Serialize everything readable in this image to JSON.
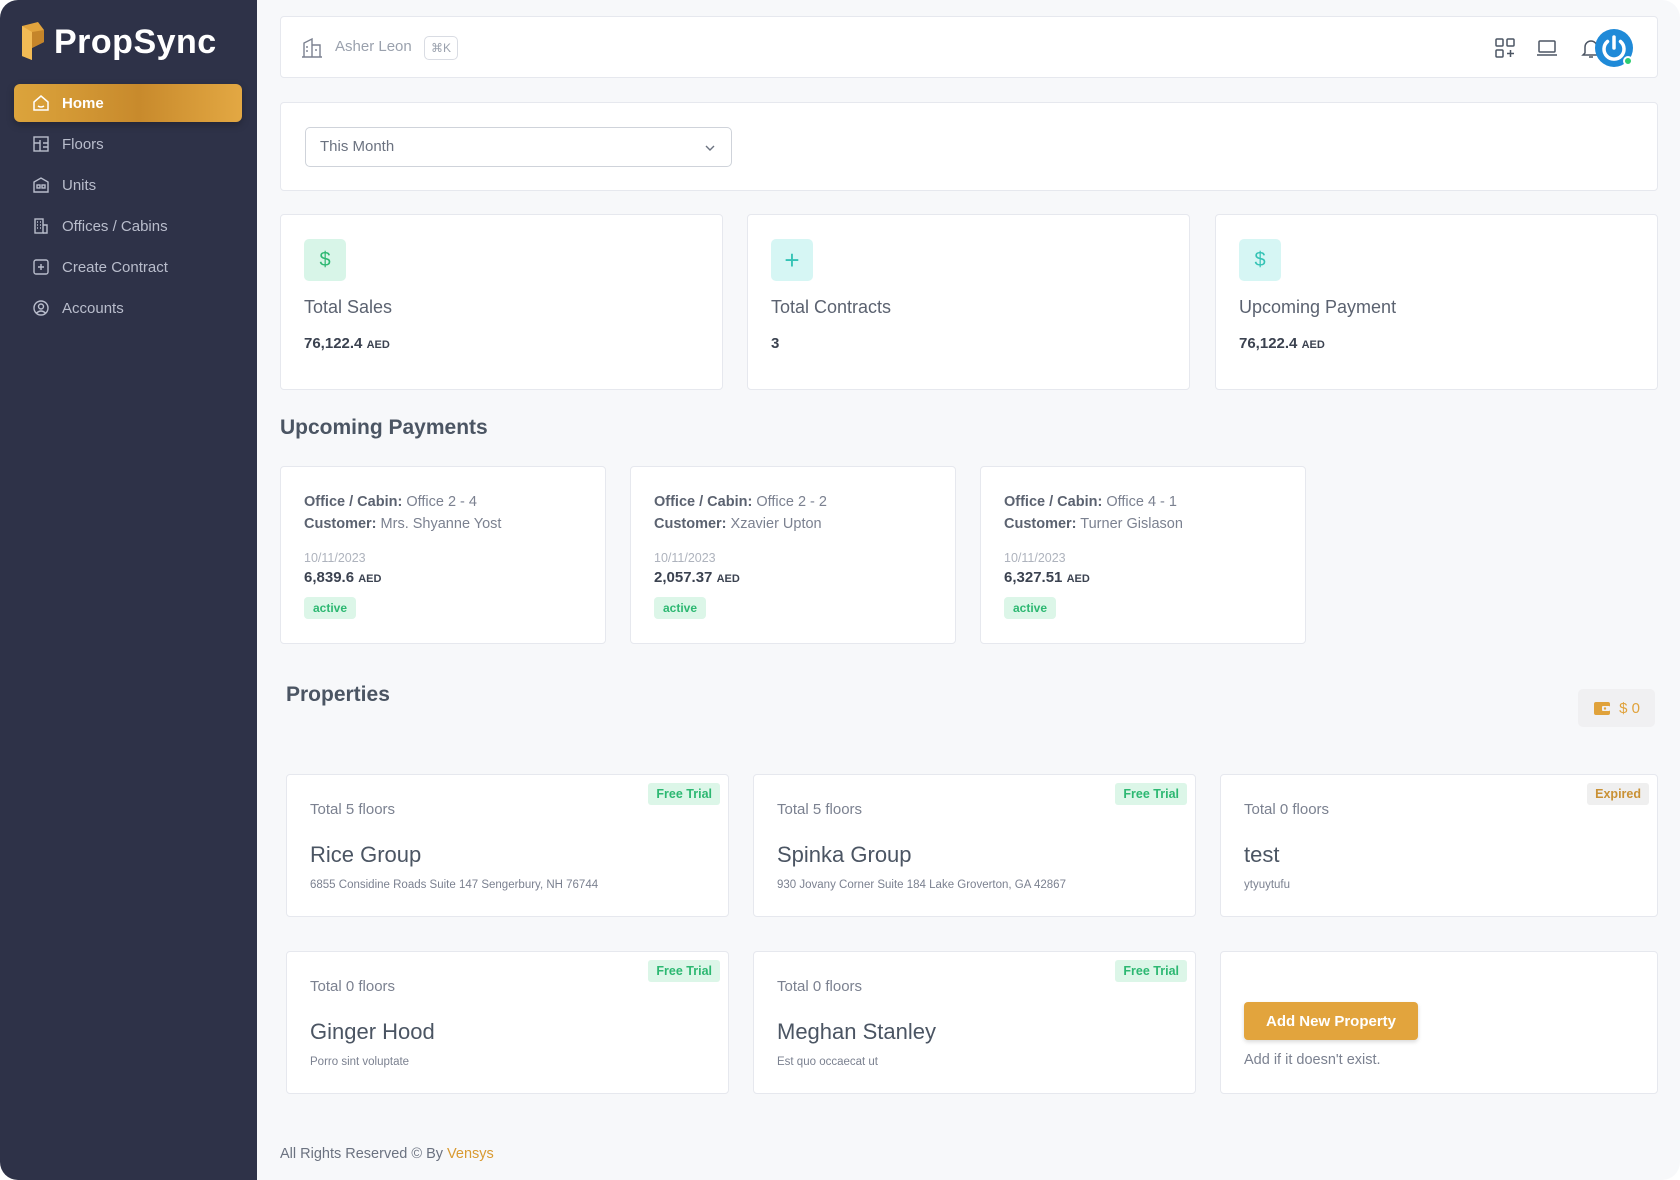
{
  "app": {
    "name": "PropSync",
    "brand_color": "#e2a43d",
    "sidebar_bg": "#2e3248"
  },
  "sidebar": {
    "items": [
      {
        "label": "Home",
        "icon": "home-icon",
        "active": true
      },
      {
        "label": "Floors",
        "icon": "floorplan-icon",
        "active": false
      },
      {
        "label": "Units",
        "icon": "units-icon",
        "active": false
      },
      {
        "label": "Offices / Cabins",
        "icon": "office-building-icon",
        "active": false
      },
      {
        "label": "Create Contract",
        "icon": "plus-square-icon",
        "active": false
      },
      {
        "label": "Accounts",
        "icon": "user-circle-icon",
        "active": false
      }
    ]
  },
  "header": {
    "user_name": "Asher Leon",
    "shortcut": "⌘K",
    "icons": [
      "apps-grid-icon",
      "laptop-icon",
      "bell-icon",
      "avatar-power-icon"
    ]
  },
  "filter": {
    "selected": "This Month"
  },
  "stats": [
    {
      "title": "Total Sales",
      "value": "76,122.4",
      "unit": "AED",
      "icon": "dollar-icon"
    },
    {
      "title": "Total Contracts",
      "value": "3",
      "unit": "",
      "icon": "plus-icon"
    },
    {
      "title": "Upcoming Payment",
      "value": "76,122.4",
      "unit": "AED",
      "icon": "dollar-icon"
    }
  ],
  "upcoming": {
    "title": "Upcoming Payments",
    "office_label": "Office / Cabin:",
    "customer_label": "Customer:",
    "items": [
      {
        "office": "Office 2 - 4",
        "customer": "Mrs. Shyanne Yost",
        "date": "10/11/2023",
        "amount": "6,839.6",
        "unit": "AED",
        "status": "active"
      },
      {
        "office": "Office 2 - 2",
        "customer": "Xzavier Upton",
        "date": "10/11/2023",
        "amount": "2,057.37",
        "unit": "AED",
        "status": "active"
      },
      {
        "office": "Office 4 - 1",
        "customer": "Turner Gislason",
        "date": "10/11/2023",
        "amount": "6,327.51",
        "unit": "AED",
        "status": "active"
      }
    ]
  },
  "properties": {
    "title": "Properties",
    "wallet": "$ 0",
    "items": [
      {
        "floors": "Total 5 floors",
        "name": "Rice Group",
        "address": "6855 Considine Roads Suite 147 Sengerbury, NH 76744",
        "tag": "Free Trial"
      },
      {
        "floors": "Total 5 floors",
        "name": "Spinka Group",
        "address": "930 Jovany Corner Suite 184 Lake Groverton, GA 42867",
        "tag": "Free Trial"
      },
      {
        "floors": "Total 0 floors",
        "name": "test",
        "address": "ytyuytufu",
        "tag": "Expired"
      },
      {
        "floors": "Total 0 floors",
        "name": "Ginger Hood",
        "address": "Porro sint voluptate",
        "tag": "Free Trial"
      },
      {
        "floors": "Total 0 floors",
        "name": "Meghan Stanley",
        "address": "Est quo occaecat ut",
        "tag": "Free Trial"
      }
    ],
    "add_button": "Add New Property",
    "add_hint": "Add if it doesn't exist."
  },
  "footer": {
    "text": "All Rights Reserved © By",
    "link": "Vensys"
  }
}
